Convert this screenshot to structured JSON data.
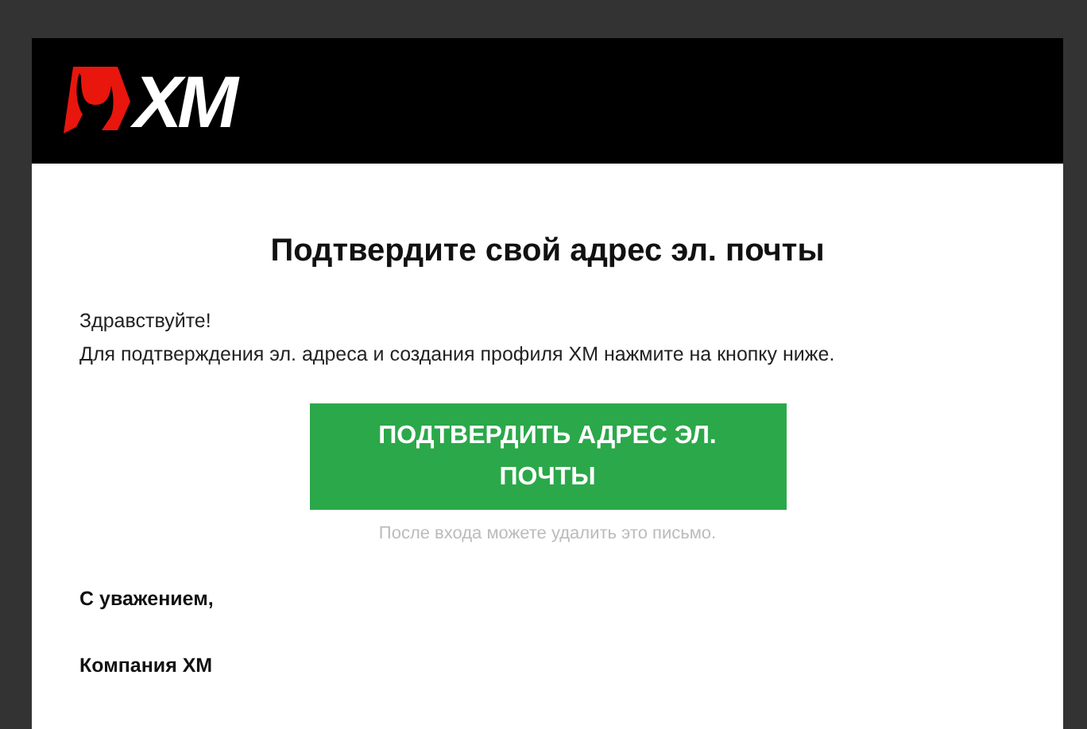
{
  "header": {
    "logo_text": "XM"
  },
  "title": "Подтвердите свой адрес эл. почты",
  "greeting": "Здравствуйте!",
  "message": "Для подтверждения эл. адреса и создания профиля XM нажмите на кнопку ниже.",
  "button": {
    "label": "ПОДТВЕРДИТЬ АДРЕС ЭЛ. ПОЧТЫ"
  },
  "note": "После входа можете удалить это письмо.",
  "signature": [
    "С уважением,",
    "Компания XM"
  ]
}
